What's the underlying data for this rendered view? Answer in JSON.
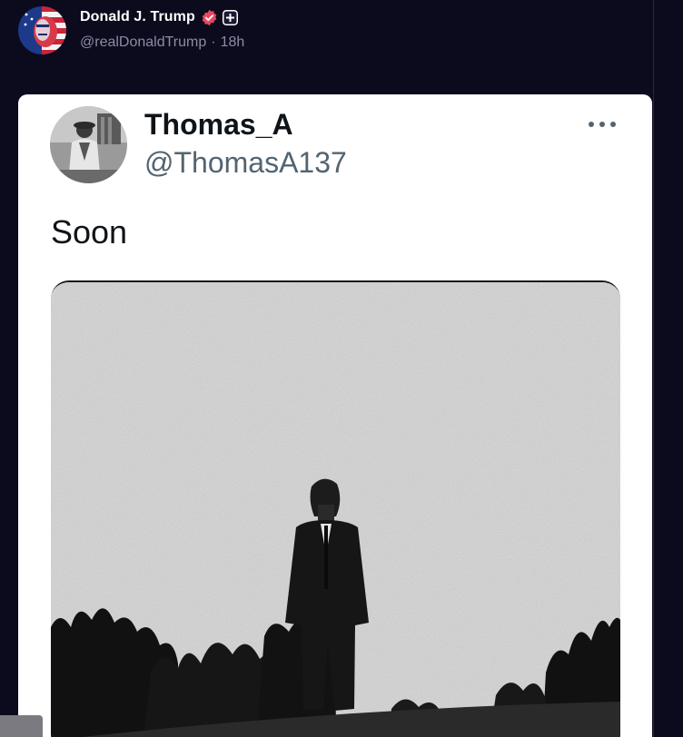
{
  "post": {
    "author_name": "Donald J. Trump",
    "handle": "@realDonaldTrump",
    "separator": "·",
    "time": "18h",
    "avatar_icon": "flag-portrait-avatar",
    "verified_icon": "verified-badge-icon",
    "plus_icon": "plus-badge-icon",
    "colors": {
      "background": "#0c0a1d",
      "verified": "#e8475f"
    }
  },
  "embedded_tweet": {
    "author_name": "Thomas_A",
    "handle": "@ThomasA137",
    "text": "Soon",
    "more_icon": "more-horizontal-icon",
    "media_description_icon": "photo-image"
  }
}
